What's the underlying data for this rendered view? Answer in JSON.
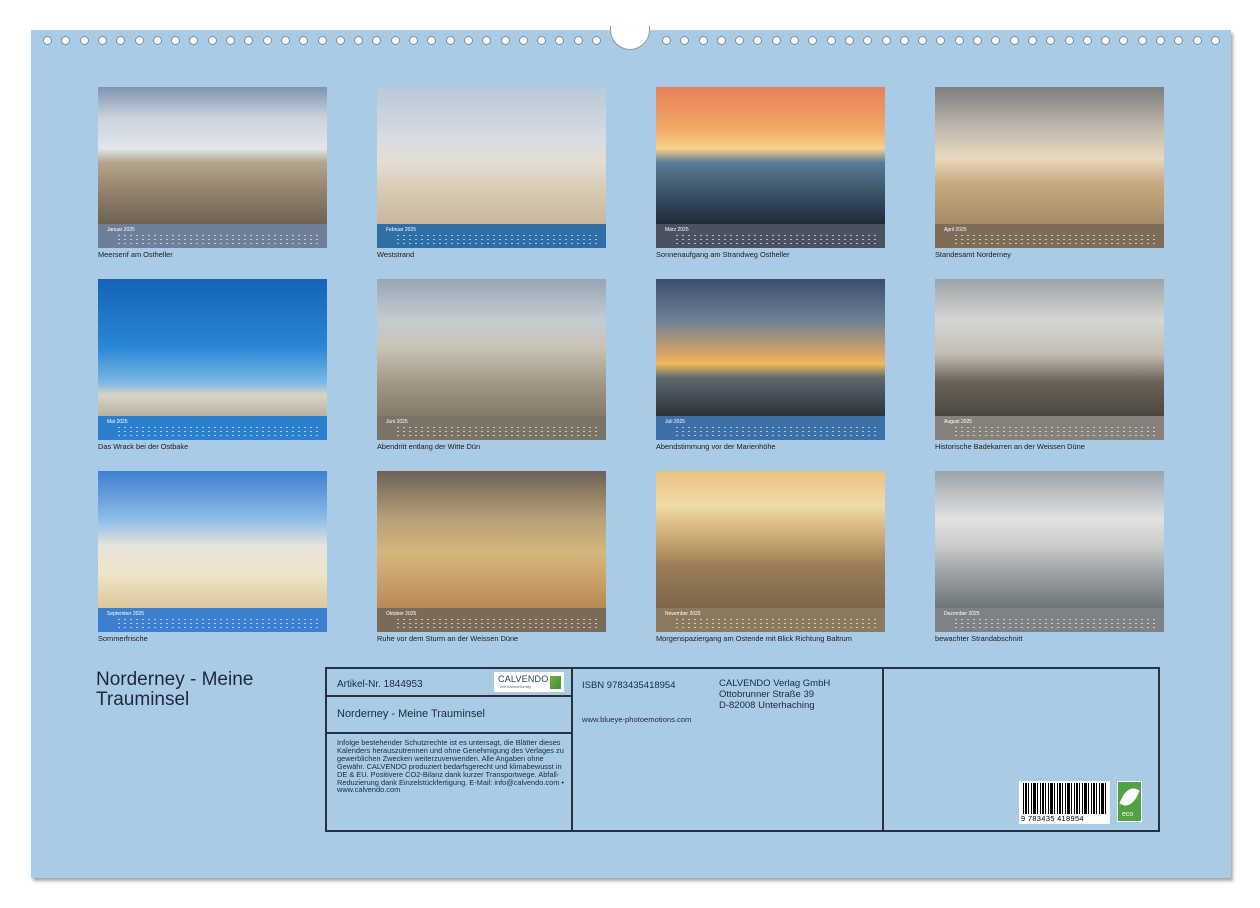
{
  "months": [
    {
      "label": "Januar 2025",
      "caption": "Meersenf am Ostheller"
    },
    {
      "label": "Februar 2025",
      "caption": "Weststrand"
    },
    {
      "label": "März 2025",
      "caption": "Sonnenaufgang am Strandweg Ostheller"
    },
    {
      "label": "April 2025",
      "caption": "Standesamt Norderney"
    },
    {
      "label": "Mai 2025",
      "caption": "Das Wrack bei der Ostbake"
    },
    {
      "label": "Juni 2025",
      "caption": "Abendritt entlang der Witte Dün"
    },
    {
      "label": "Juli 2025",
      "caption": "Abendstimmung vor der Marienhöhe"
    },
    {
      "label": "August 2025",
      "caption": "Historische Badekarren an der Weissen Düne"
    },
    {
      "label": "September 2025",
      "caption": "Sommerfrische"
    },
    {
      "label": "Oktober 2025",
      "caption": "Ruhe vor dem Sturm an der Weissen Düne"
    },
    {
      "label": "November 2025",
      "caption": "Morgenspaziergang am Ostende mit Blick Richtung Baltrum"
    },
    {
      "label": "Dezember 2025",
      "caption": "bewachter Strandabschnitt"
    }
  ],
  "title": "Norderney - Meine Trauminsel",
  "info": {
    "article": "Artikel-Nr. 1844953",
    "logo_name": "CALVENDO",
    "logo_sub": "Ihre Kalenderverlag",
    "box_title": "Norderney - Meine Trauminsel",
    "legal": "Infolge bestehender Schutzrechte ist es untersagt, die Blätter dieses Kalenders herauszutrennen und ohne Genehmigung des Verlages zu gewerblichen Zwecken weiterzuverwenden. Alle Angaben ohne Gewähr. CALVENDO produziert bedarfsgerecht und klimabewusst in DE & EU. Positivere CO2-Bilanz dank kurzer Transportwege. Abfall-Reduzierung dank Einzelstückfertigung. E-Mail: info@calvendo.com • www.calvendo.com",
    "isbn": "ISBN 9783435418954",
    "website": "www.blueye-photoemotions.com",
    "publisher": "CALVENDO Verlag GmbH",
    "street": "Ottobrunner Straße 39",
    "city": "D-82008 Unterhaching",
    "barcode_number": "9 783435 418954",
    "eco_label": "eco"
  },
  "colors": {
    "background": "#a9cbe6",
    "border": "#263240"
  }
}
